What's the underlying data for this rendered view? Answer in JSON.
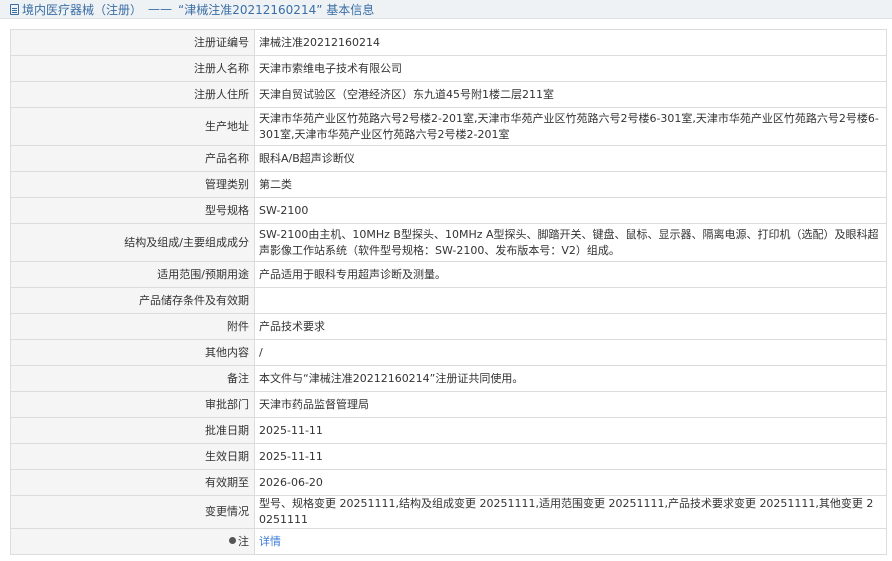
{
  "header": {
    "title": "境内医疗器械（注册）",
    "separator": "——",
    "subtitle": "“津械注准20212160214” 基本信息"
  },
  "rows": [
    {
      "label": "注册证编号",
      "value": "津械注准20212160214"
    },
    {
      "label": "注册人名称",
      "value": "天津市索维电子技术有限公司"
    },
    {
      "label": "注册人住所",
      "value": "天津自贸试验区（空港经济区）东九道45号附1楼二层211室"
    },
    {
      "label": "生产地址",
      "value": "天津市华苑产业区竹苑路六号2号楼2-201室,天津市华苑产业区竹苑路六号2号楼6-301室,天津市华苑产业区竹苑路六号2号楼6-301室,天津市华苑产业区竹苑路六号2号楼2-201室"
    },
    {
      "label": "产品名称",
      "value": "眼科A/B超声诊断仪"
    },
    {
      "label": "管理类别",
      "value": "第二类"
    },
    {
      "label": "型号规格",
      "value": "SW-2100"
    },
    {
      "label": "结构及组成/主要组成成分",
      "value": "SW-2100由主机、10MHz B型探头、10MHz A型探头、脚踏开关、键盘、鼠标、显示器、隔离电源、打印机（选配）及眼科超声影像工作站系统（软件型号规格：SW-2100、发布版本号：V2）组成。"
    },
    {
      "label": "适用范围/预期用途",
      "value": "产品适用于眼科专用超声诊断及测量。"
    },
    {
      "label": "产品储存条件及有效期",
      "value": ""
    },
    {
      "label": "附件",
      "value": "产品技术要求"
    },
    {
      "label": "其他内容",
      "value": "/"
    },
    {
      "label": "备注",
      "value": "本文件与“津械注准20212160214”注册证共同使用。"
    },
    {
      "label": "审批部门",
      "value": "天津市药品监督管理局"
    },
    {
      "label": "批准日期",
      "value": "2025-11-11"
    },
    {
      "label": "生效日期",
      "value": "2025-11-11"
    },
    {
      "label": "有效期至",
      "value": "2026-06-20"
    },
    {
      "label": "变更情况",
      "value": "型号、规格变更 20251111,结构及组成变更 20251111,适用范围变更 20251111,产品技术要求变更 20251111,其他变更 20251111"
    }
  ],
  "note": {
    "label": "注",
    "link_text": "详情",
    "icon": "note-icon"
  }
}
